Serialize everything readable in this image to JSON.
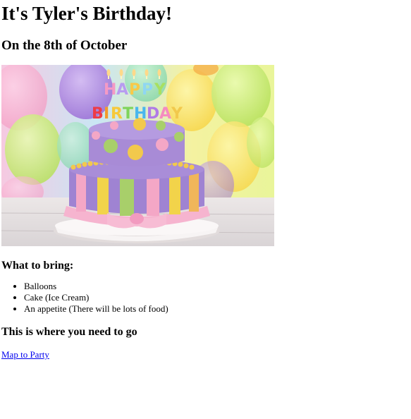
{
  "page": {
    "title": "It's Tyler's Birthday!",
    "subtitle": "On the 8th of October"
  },
  "image": {
    "subject": "cake",
    "candle_text": "HAPPY BIRTHDAY",
    "colors": {
      "purple": "#9b7fd0",
      "pink": "#f4a7c6",
      "yellow": "#f2d34a",
      "green": "#a8cf6a",
      "orange": "#f0b65a"
    }
  },
  "bring": {
    "heading": "What to bring:",
    "items": [
      "Balloons",
      "Cake (Ice Cream)",
      "An appetite (There will be lots of food)"
    ]
  },
  "directions": {
    "heading": "This is where you need to go",
    "link_text": "Map to Party"
  }
}
